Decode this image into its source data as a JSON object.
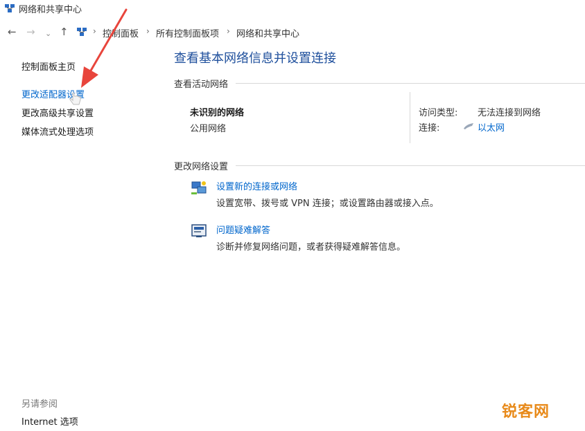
{
  "window": {
    "title": "网络和共享中心"
  },
  "address": {
    "crumbs": [
      "控制面板",
      "所有控制面板项",
      "网络和共享中心"
    ],
    "separator": "›"
  },
  "sidebar": {
    "items": [
      {
        "label": "控制面板主页"
      },
      {
        "label": "更改适配器设置"
      },
      {
        "label": "更改高级共享设置"
      },
      {
        "label": "媒体流式处理选项"
      }
    ],
    "see_also_label": "另请参阅",
    "see_also_items": [
      {
        "label": "Internet 选项"
      }
    ]
  },
  "main": {
    "title": "查看基本网络信息并设置连接",
    "active_section": "查看活动网络",
    "network": {
      "name": "未识别的网络",
      "type": "公用网络",
      "access_label": "访问类型:",
      "access_value": "无法连接到网络",
      "conn_label": "连接:",
      "conn_value": "以太网"
    },
    "change_section": "更改网络设置",
    "tasks": [
      {
        "link": "设置新的连接或网络",
        "desc": "设置宽带、拨号或 VPN 连接；或设置路由器或接入点。"
      },
      {
        "link": "问题疑难解答",
        "desc": "诊断并修复网络问题，或者获得疑难解答信息。"
      }
    ]
  },
  "watermark": {
    "text": "锐客网"
  },
  "colors": {
    "accent_title": "#1e4f9c",
    "link": "#0066cc",
    "arrow": "#e8453c"
  }
}
